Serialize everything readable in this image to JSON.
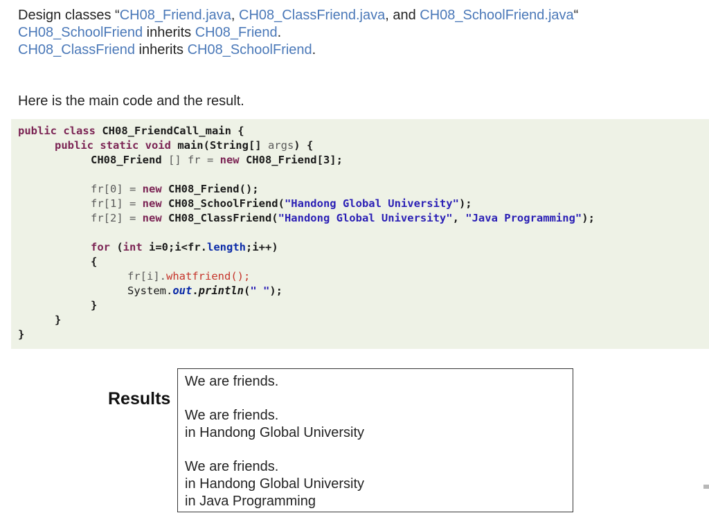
{
  "intro": {
    "line1": {
      "prefix": "Design classes “",
      "class_a": "CH08_Friend.java",
      "sep1": ", ",
      "class_b": "CH08_ClassFriend.java",
      "sep2": ", and ",
      "class_c": "CH08_SchoolFriend.java",
      "suffix": "“"
    },
    "line2": {
      "sub": "CH08_SchoolFriend",
      "verb": " inherits ",
      "sup": "CH08_Friend",
      "end": "."
    },
    "line3": {
      "sub": "CH08_ClassFriend",
      "verb": " inherits ",
      "sup": "CH08_SchoolFriend",
      "end": "."
    }
  },
  "lead_text": "Here is the main code and the result.",
  "code": {
    "l1_kw": "public class ",
    "l1_name": "CH08_FriendCall_main {",
    "l2_kw": "public static void ",
    "l2_main": "main(String[] ",
    "l2_args": "args",
    "l2_end": ") {",
    "l3_type": "CH08_Friend ",
    "l3_br": "[] fr = ",
    "l3_new": "new ",
    "l3_rest": "CH08_Friend[3];",
    "l4_lhs": "fr[0] = ",
    "l4_new": "new ",
    "l4_rest": "CH08_Friend();",
    "l5_lhs": "fr[1] = ",
    "l5_new": "new ",
    "l5_cls": "CH08_SchoolFriend(",
    "l5_str": "\"Handong Global University\"",
    "l5_end": ");",
    "l6_lhs": "fr[2] = ",
    "l6_new": "new ",
    "l6_cls": "CH08_ClassFriend(",
    "l6_str1": "\"Handong Global University\"",
    "l6_comma": ", ",
    "l6_str2": "\"Java Programming\"",
    "l6_end": ");",
    "l7_for": "for ",
    "l7_open": "(",
    "l7_int": "int ",
    "l7_cond": "i=0;i<fr.",
    "l7_len": "length",
    "l7_end": ";i++)",
    "l8": "{",
    "l9_obj": "fr[i].",
    "l9_call": "whatfriend();",
    "l10_sys": "System.",
    "l10_out": "out",
    "l10_dot": ".",
    "l10_println": "println",
    "l10_open": "(",
    "l10_str": "\" \"",
    "l10_end": ");",
    "l11": "}",
    "l12": "}",
    "l13": "}"
  },
  "results": {
    "label": "Results",
    "block1": [
      "We are friends."
    ],
    "block2": [
      "We are friends.",
      "in Handong Global University"
    ],
    "block3": [
      "We are friends.",
      "in Handong Global University",
      "in Java Programming"
    ]
  }
}
